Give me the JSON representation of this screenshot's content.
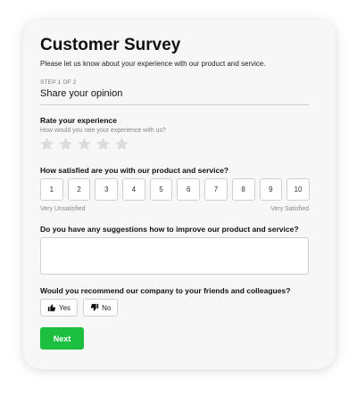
{
  "survey": {
    "title": "Customer Survey",
    "subtitle": "Please let us know about your experience with our product and service.",
    "step_label": "STEP 1 OF 2",
    "step_title": "Share your opinion"
  },
  "rating": {
    "label": "Rate your experience",
    "help": "How would you rate your experience with us?",
    "max_stars": 5,
    "selected_stars": 0,
    "star_color": "#dcdcdc"
  },
  "satisfaction": {
    "label": "How satisfied are you with our product and service?",
    "options": [
      "1",
      "2",
      "3",
      "4",
      "5",
      "6",
      "7",
      "8",
      "9",
      "10"
    ],
    "min_label": "Very Unsatisfied",
    "max_label": "Very Satisfied"
  },
  "suggestions": {
    "label": "Do you have any suggestions how to improve our product and service?",
    "value": "",
    "placeholder": ""
  },
  "recommend": {
    "label": "Would you recommend our company to your friends and colleagues?",
    "yes_label": "Yes",
    "yes_icon": "thumbs-up-icon",
    "no_label": "No",
    "no_icon": "thumbs-down-icon"
  },
  "actions": {
    "next_label": "Next",
    "accent_color": "#1dbf41"
  }
}
